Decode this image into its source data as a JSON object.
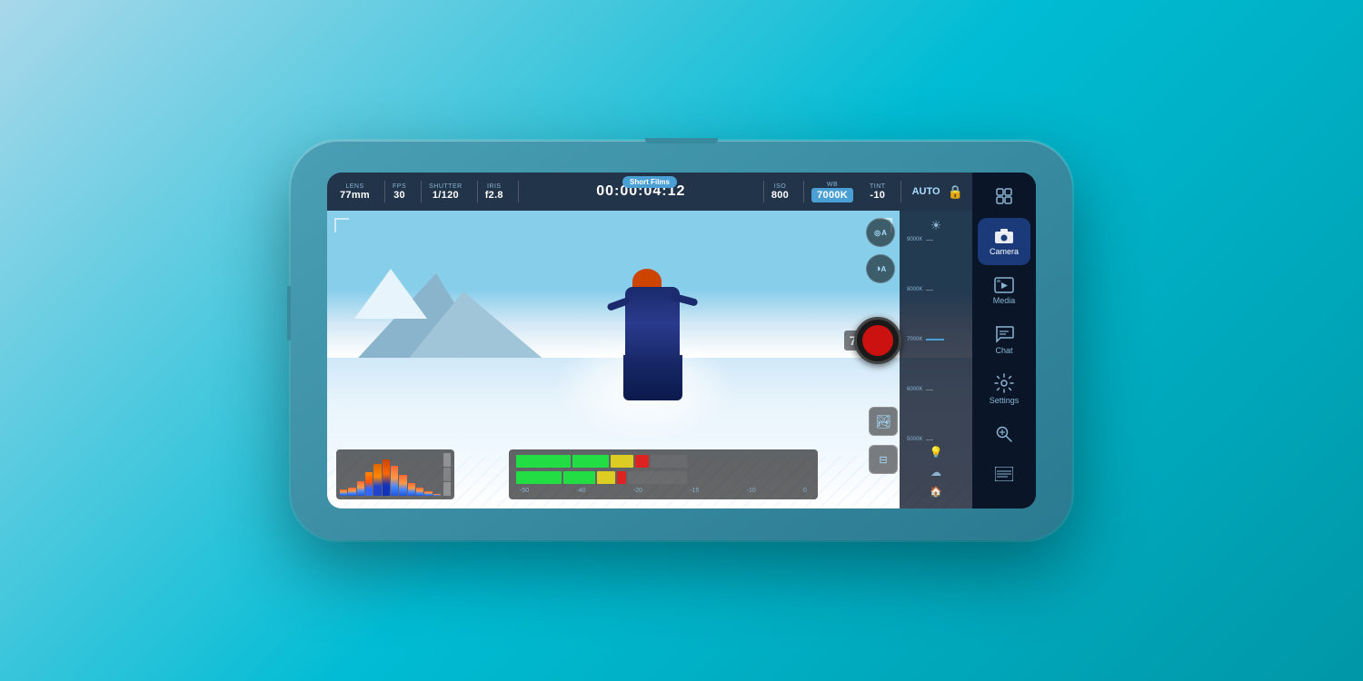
{
  "background": {
    "gradient_start": "#a8d8ea",
    "gradient_end": "#0097a7"
  },
  "phone": {
    "color": "#4a9fb5"
  },
  "camera": {
    "preset_label": "Short Films",
    "timecode": "00:00:04:12",
    "lens_label": "LENS",
    "lens_value": "77mm",
    "fps_label": "FPS",
    "fps_value": "30",
    "shutter_label": "SHUTTER",
    "shutter_value": "1/120",
    "iris_label": "IRIS",
    "iris_value": "f2.8",
    "iso_label": "ISO",
    "iso_value": "800",
    "wb_label": "WB",
    "wb_value": "7000K",
    "tint_label": "TINT",
    "tint_value": "-10",
    "auto_label": "AUTO",
    "wb_temp_display": "7000K",
    "wb_scale": {
      "top": "9000K",
      "upper_mid": "8000K",
      "mid": "7000K",
      "lower_mid": "6000K",
      "bottom": "5000K"
    }
  },
  "sidebar": {
    "items": [
      {
        "id": "camera",
        "label": "Camera",
        "icon": "📷",
        "active": true
      },
      {
        "id": "media",
        "label": "Media",
        "icon": "▶",
        "active": false
      },
      {
        "id": "chat",
        "label": "Chat",
        "icon": "💬",
        "active": false
      },
      {
        "id": "settings",
        "label": "Settings",
        "icon": "⚙",
        "active": false
      }
    ]
  },
  "controls": {
    "focus_auto": "A",
    "exposure_auto": "A"
  }
}
